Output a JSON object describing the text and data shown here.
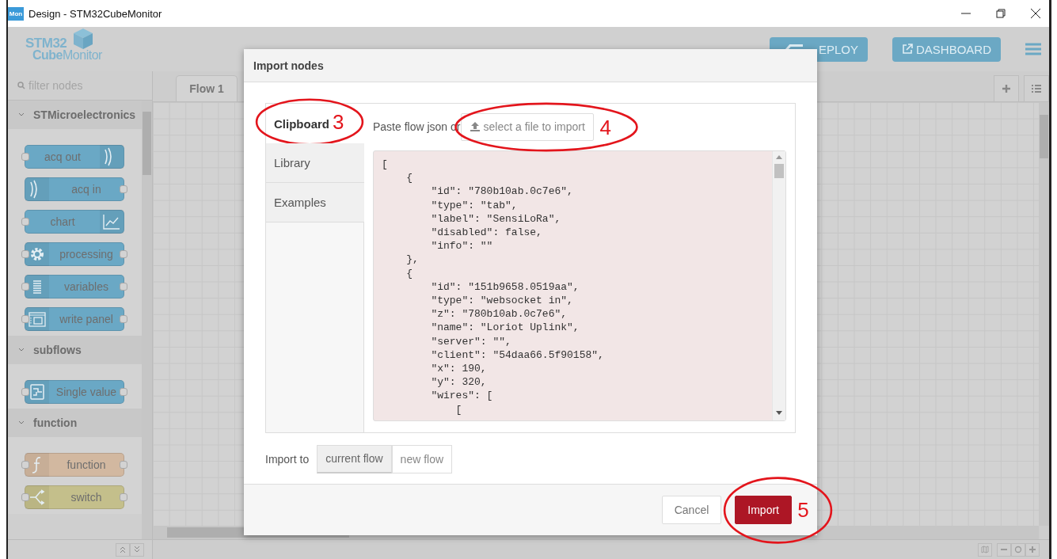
{
  "window": {
    "app_icon": "Mon",
    "title": "Design - STM32CubeMonitor"
  },
  "header": {
    "logo_top": "STM32",
    "logo_bold": "Cube",
    "logo_rest": "Monitor",
    "buttons": [
      {
        "label": "EPLOY",
        "kind": "deploy"
      },
      {
        "label": "DASHBOARD",
        "kind": "dashboard"
      }
    ]
  },
  "palette": {
    "filter_placeholder": "filter nodes",
    "categories": [
      {
        "name": "STMicroelectronics",
        "expanded": true,
        "nodes": [
          {
            "label": "acq out",
            "kind": "acqout",
            "inputs": true,
            "outputs": false,
            "color": "#6aa8c5"
          },
          {
            "label": "acq in",
            "kind": "acqin",
            "inputs": false,
            "outputs": true,
            "color": "#6aa8c5"
          },
          {
            "label": "chart",
            "kind": "chart",
            "inputs": true,
            "outputs": false,
            "color": "#6aa8c5"
          },
          {
            "label": "processing",
            "kind": "processing",
            "inputs": true,
            "outputs": true,
            "color": "#6aa8c5"
          },
          {
            "label": "variables",
            "kind": "variables",
            "inputs": true,
            "outputs": true,
            "color": "#6aa8c5"
          },
          {
            "label": "write panel",
            "kind": "panel",
            "inputs": true,
            "outputs": true,
            "color": "#6aa8c5"
          }
        ]
      },
      {
        "name": "subflows",
        "expanded": true,
        "nodes": [
          {
            "label": "Single value",
            "kind": "subflow",
            "inputs": true,
            "outputs": true,
            "color": "#6aa8c5"
          }
        ]
      },
      {
        "name": "function",
        "expanded": true,
        "nodes": [
          {
            "label": "function",
            "kind": "function",
            "inputs": true,
            "outputs": true,
            "color": "#d2b8a0"
          },
          {
            "label": "switch",
            "kind": "switch",
            "inputs": true,
            "outputs": true,
            "color": "#c4bf8b"
          }
        ]
      }
    ]
  },
  "workspace": {
    "tabs": [
      {
        "label": "Flow 1",
        "selected": true
      }
    ]
  },
  "dialog": {
    "title": "Import nodes",
    "tabs": [
      {
        "label": "Clipboard",
        "selected": true,
        "annotation": "3"
      },
      {
        "label": "Library",
        "selected": false
      },
      {
        "label": "Examples",
        "selected": false
      }
    ],
    "paste_label": "Paste flow json or",
    "file_button": {
      "label": "select a file to import",
      "annotation": "4"
    },
    "code_lines": [
      "[",
      "    {",
      "        \"id\": \"780b10ab.0c7e6\",",
      "        \"type\": \"tab\",",
      "        \"label\": \"SensiLoRa\",",
      "        \"disabled\": false,",
      "        \"info\": \"\"",
      "    },",
      "    {",
      "        \"id\": \"151b9658.0519aa\",",
      "        \"type\": \"websocket in\",",
      "        \"z\": \"780b10ab.0c7e6\",",
      "        \"name\": \"Loriot Uplink\",",
      "        \"server\": \"\",",
      "        \"client\": \"54daa66.5f90158\",",
      "        \"x\": 190,",
      "        \"y\": 320,",
      "        \"wires\": [",
      "            ["
    ],
    "import_to_label": "Import to",
    "import_targets": [
      {
        "label": "current flow",
        "selected": true
      },
      {
        "label": "new flow",
        "selected": false
      }
    ],
    "buttons": [
      {
        "label": "Cancel",
        "kind": "secondary"
      },
      {
        "label": "Import",
        "kind": "primary",
        "annotation": "5"
      }
    ]
  }
}
